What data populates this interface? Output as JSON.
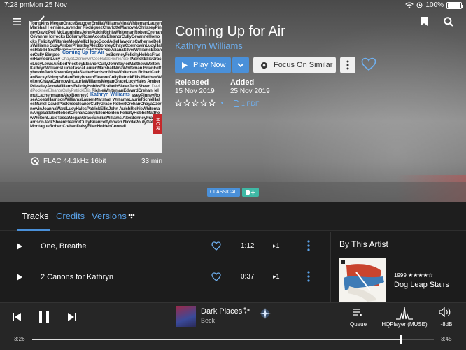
{
  "status_bar": {
    "time": "7:28 pm",
    "date": "Mon 25 Nov",
    "battery": "100%"
  },
  "album": {
    "title": "Coming Up for Air",
    "artist": "Kathryn Williams",
    "cover_highlight_title": "Coming Up for Air",
    "cover_highlight_artist": "Kathryn Williams",
    "cover_badge": "HCR",
    "format": "FLAC 44.1kHz 16bit",
    "duration": "33 min",
    "released_label": "Released",
    "released_value": "15 Nov 2019",
    "added_label": "Added",
    "added_value": "25 Nov 2019",
    "rating": 0,
    "pdf_label": "1 PDF"
  },
  "actions": {
    "play_now": "Play Now",
    "focus_on_similar": "Focus On Similar"
  },
  "tags": {
    "genre": "CLASSICAL"
  },
  "tabs": [
    {
      "label": "Tracks",
      "active": true
    },
    {
      "label": "Credits",
      "active": false
    },
    {
      "label": "Versions",
      "active": false
    }
  ],
  "tracks": [
    {
      "name": "One, Breathe",
      "duration": "1:12",
      "plays": "▸1"
    },
    {
      "name": "2 Canons for Kathryn",
      "duration": "0:37",
      "plays": "▸1"
    }
  ],
  "by_artist": {
    "heading": "By This Artist",
    "album_year": "1999 ★★★★☆",
    "album_title": "Dog Leap Stairs"
  },
  "now_playing": {
    "title": "Dark Places",
    "artist": "Beck",
    "elapsed": "3:26",
    "total": "3:45",
    "progress": 0.916,
    "queue_label": "Queue",
    "output_label": "HQPlayer (MUSE)",
    "volume_label": "-8dB"
  },
  "colors": {
    "accent": "#4a90d9",
    "link": "#6fb0f0",
    "tag_add": "#3fb8a5"
  }
}
